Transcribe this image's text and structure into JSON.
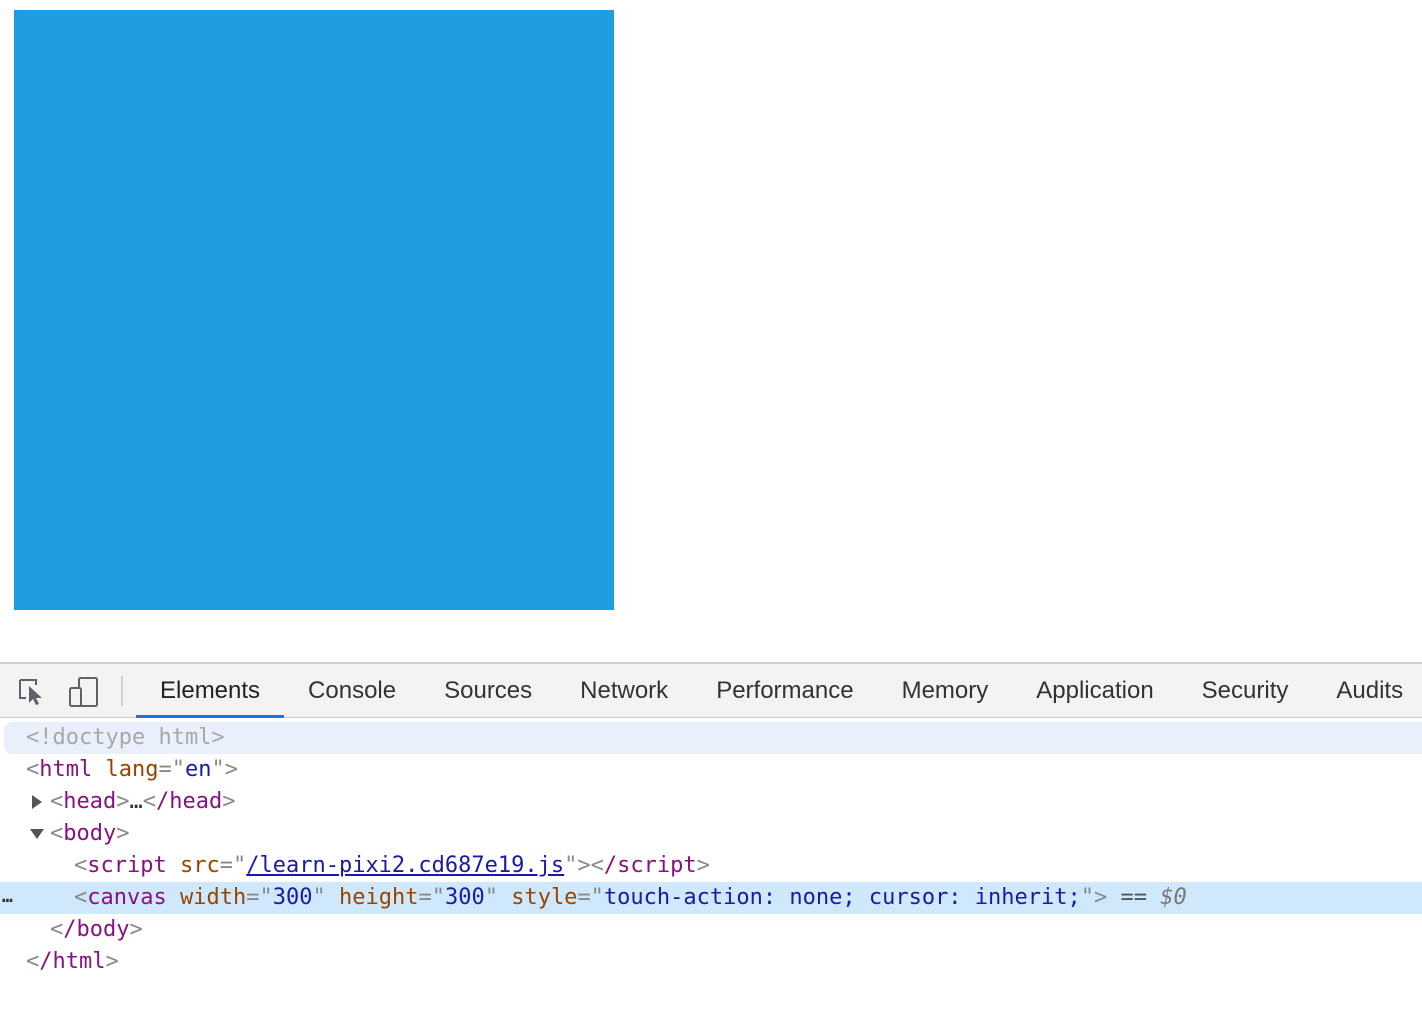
{
  "page": {
    "canvas_color": "#1e9de0"
  },
  "devtools": {
    "toolbar": {
      "icons": [
        "inspect-element-icon",
        "device-toolbar-icon"
      ]
    },
    "tabs": [
      {
        "label": "Elements",
        "active": true
      },
      {
        "label": "Console",
        "active": false
      },
      {
        "label": "Sources",
        "active": false
      },
      {
        "label": "Network",
        "active": false
      },
      {
        "label": "Performance",
        "active": false
      },
      {
        "label": "Memory",
        "active": false
      },
      {
        "label": "Application",
        "active": false
      },
      {
        "label": "Security",
        "active": false
      },
      {
        "label": "Audits",
        "active": false
      }
    ],
    "accent_color": "#1a73e8",
    "dom": {
      "doctype": "<!doctype html>",
      "html_open": {
        "tag": "html",
        "attr_name": "lang",
        "attr_value": "en"
      },
      "head": {
        "open": "head",
        "ellipsis": "…",
        "close": "/head"
      },
      "body_open": "body",
      "script": {
        "tag": "script",
        "attr_name": "src",
        "attr_value": "/learn-pixi2.cd687e19.js",
        "close": "/script"
      },
      "canvas": {
        "tag": "canvas",
        "width_attr": "width",
        "width_value": "300",
        "height_attr": "height",
        "height_value": "300",
        "style_attr": "style",
        "style_value": "touch-action: none; cursor: inherit;",
        "eq_marker": "==",
        "dollar": "$0",
        "gutter": "…"
      },
      "body_close": "/body",
      "html_close": "/html"
    }
  }
}
